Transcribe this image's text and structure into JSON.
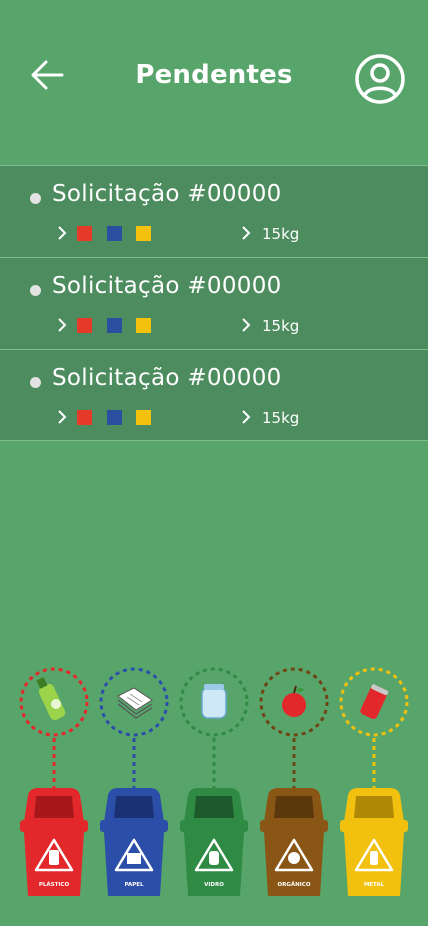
{
  "header": {
    "title": "Pendentes",
    "back_icon": "arrow-left-icon",
    "profile_icon": "user-circle-icon"
  },
  "requests": [
    {
      "title": "Solicitação #00000",
      "categories": [
        "#e53a2a",
        "#2a4fa0",
        "#f4c10f"
      ],
      "weight": "15kg"
    },
    {
      "title": "Solicitação #00000",
      "categories": [
        "#e53a2a",
        "#2a4fa0",
        "#f4c10f"
      ],
      "weight": "15kg"
    },
    {
      "title": "Solicitação #00000",
      "categories": [
        "#e53a2a",
        "#2a4fa0",
        "#f4c10f"
      ],
      "weight": "15kg"
    }
  ],
  "bins": [
    {
      "label": "PLÁSTICO",
      "color": "#e3282b",
      "dark": "#a8181b",
      "item_icon": "bottle-icon"
    },
    {
      "label": "PAPEL",
      "color": "#2b4fa8",
      "dark": "#1a3274",
      "item_icon": "newspaper-icon"
    },
    {
      "label": "VIDRO",
      "color": "#2f8a43",
      "dark": "#1d5a2b",
      "item_icon": "jar-icon"
    },
    {
      "label": "ORGÂNICO",
      "color": "#8a5616",
      "dark": "#5b390c",
      "item_icon": "apple-icon"
    },
    {
      "label": "METAL",
      "color": "#f2c10f",
      "dark": "#b08808",
      "item_icon": "can-icon"
    }
  ],
  "colors": {
    "background": "#58a56c",
    "row_background": "#4d8c5e"
  }
}
